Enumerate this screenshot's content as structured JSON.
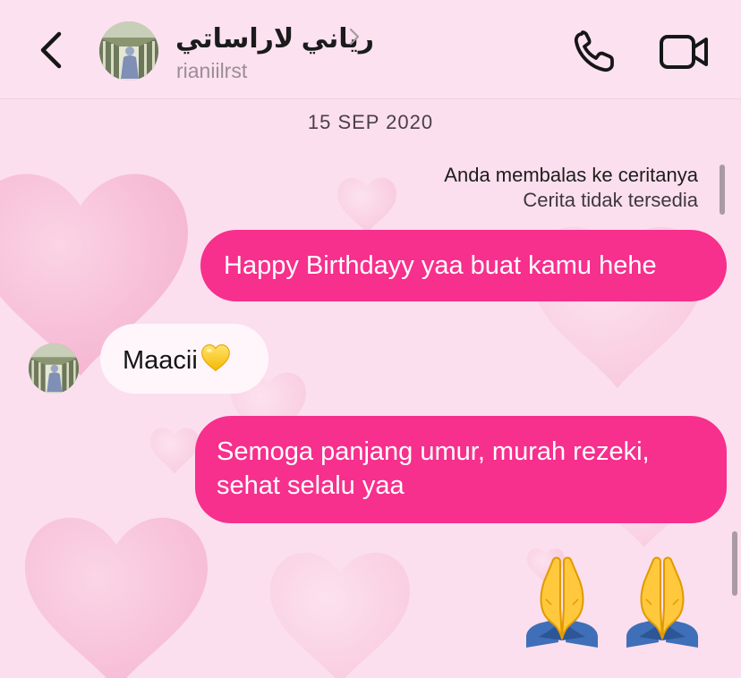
{
  "header": {
    "contact_name": "رياني لاراساتي",
    "username": "rianiilrst",
    "back_icon": "chevron-left-icon",
    "call_icon": "phone-icon",
    "video_icon": "video-camera-icon"
  },
  "thread": {
    "date_separator": "15 SEP 2020",
    "story_reply": {
      "label": "Anda membalas ke ceritanya",
      "status": "Cerita tidak tersedia"
    },
    "messages": [
      {
        "direction": "sent",
        "text": "Happy Birthdayy yaa buat kamu hehe"
      },
      {
        "direction": "received",
        "text": "Maacii",
        "emoji": "yellow-heart-icon"
      },
      {
        "direction": "sent",
        "text": "Semoga panjang umur, murah rezeki, sehat selalu yaa"
      },
      {
        "direction": "sent",
        "emoji": [
          "folded-hands-icon",
          "folded-hands-icon"
        ]
      }
    ]
  },
  "theme": {
    "sent_bubble": "#f72f8d",
    "received_bubble": "#fff7fb",
    "background": "#fbdfee",
    "heart_pattern": "#f7b5d1"
  }
}
